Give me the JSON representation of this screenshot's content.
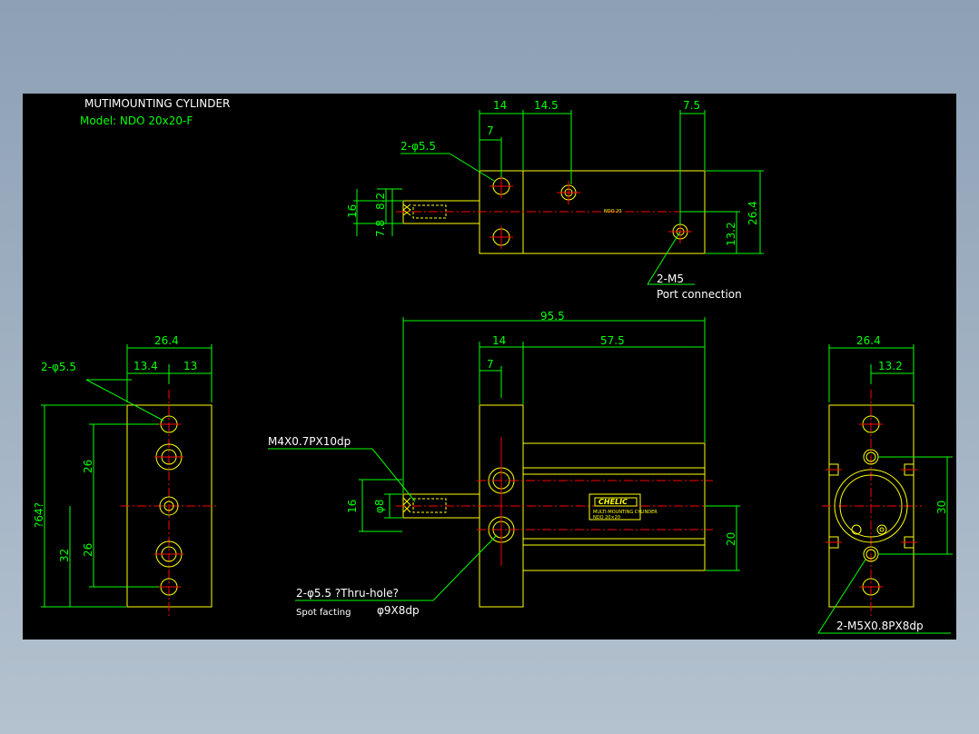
{
  "title": "MUTIMOUNTING CYLINDER",
  "model": "Model: NDO 20x20-F",
  "top_view": {
    "dim_14": "14",
    "dim_14_5": "14.5",
    "dim_7_5": "7.5",
    "dim_7": "7",
    "hole_label": "2-φ5.5",
    "dim_16": "16",
    "dim_7_8": "7.8",
    "dim_8_2": "8.2",
    "dim_13_2": "13.2",
    "dim_26_4": "26.4",
    "port_label": "2-M5",
    "port_note": "Port connection",
    "body_text": "NDO 20"
  },
  "left_view": {
    "dim_26_4": "26.4",
    "dim_13_4": "13.4",
    "dim_13": "13",
    "hole_label": "2-φ5.5",
    "dim_64": "?64?",
    "dim_26a": "26",
    "dim_26b": "26",
    "dim_32": "32"
  },
  "front_view": {
    "dim_95_5": "95.5",
    "dim_14": "14",
    "dim_57_5": "57.5",
    "dim_7": "7",
    "thread_label": "M4X0.7PX10dp",
    "dim_16": "16",
    "dim_8": "φ8",
    "dim_20": "20",
    "hole_label": "2-φ5.5 ?Thru-hole?",
    "spot_label": "Spot facting",
    "spot_dim": "φ9X8dp",
    "brand": "CHELIC",
    "plate_line1": "MULTI-MOUNTING CYLINDER",
    "plate_line2": "NDO 20×20"
  },
  "right_view": {
    "dim_26_4": "26.4",
    "dim_13_2": "13.2",
    "dim_30": "30",
    "thread_label": "2-M5X0.8PX8dp"
  }
}
